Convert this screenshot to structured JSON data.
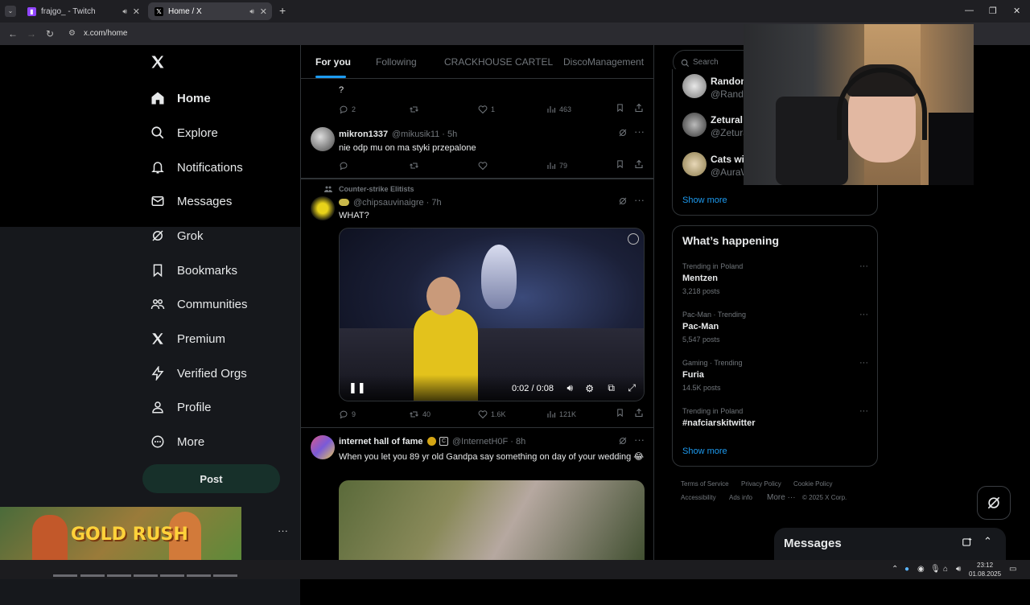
{
  "browser": {
    "tabs": [
      {
        "title": "frajgo_ - Twitch",
        "active": false
      },
      {
        "title": "Home / X",
        "active": true
      }
    ],
    "url": "x.com/home"
  },
  "leftnav": {
    "items": [
      {
        "label": "Home",
        "icon": "home-icon",
        "active": true
      },
      {
        "label": "Explore",
        "icon": "search-icon"
      },
      {
        "label": "Notifications",
        "icon": "bell-icon"
      },
      {
        "label": "Messages",
        "icon": "mail-icon"
      },
      {
        "label": "Grok",
        "icon": "grok-icon"
      },
      {
        "label": "Bookmarks",
        "icon": "bookmark-icon"
      },
      {
        "label": "Communities",
        "icon": "people-icon"
      },
      {
        "label": "Premium",
        "icon": "x-logo-icon"
      },
      {
        "label": "Verified Orgs",
        "icon": "lightning-icon"
      },
      {
        "label": "Profile",
        "icon": "person-icon"
      },
      {
        "label": "More",
        "icon": "more-circle-icon"
      }
    ],
    "post_label": "Post",
    "ad_title": "GOLD RUSH",
    "more_dots": "···"
  },
  "feed": {
    "tabs": [
      "For you",
      "Following",
      "CRACKHOUSE CARTEL",
      "DiscoManagement"
    ],
    "active_tab": 0,
    "tweets": [
      {
        "text": "?",
        "replies": "2",
        "retweets": "",
        "likes": "1",
        "views": "463"
      },
      {
        "name": "mikron1337",
        "handle": "@mikusik11 · 5h",
        "text": "nie odp mu on ma styki przepalone",
        "replies": "",
        "retweets": "",
        "likes": "",
        "views": "79"
      },
      {
        "community": "Counter-strike Elitists",
        "name": "",
        "handle": "@chipsauvinaigre · 7h",
        "text": "WHAT?",
        "video_time": "0:02 / 0:08",
        "replies": "9",
        "retweets": "40",
        "likes": "1.6K",
        "views": "121K"
      },
      {
        "name": "internet hall of fame",
        "handle": "@InternetH0F · 8h",
        "text": "When you let you 89 yr old Gandpa say something on day of your wedding 😂"
      }
    ]
  },
  "right": {
    "search_placeholder": "Search",
    "who_to_follow": [
      {
        "name": "Random",
        "handle": "@Rando"
      },
      {
        "name": "Zetural",
        "handle": "@Zetura"
      },
      {
        "name": "Cats wit",
        "handle": "@AuraW"
      }
    ],
    "show_more": "Show more",
    "happening_title": "What’s happening",
    "trends": [
      {
        "meta": "Trending in Poland",
        "name": "Mentzen",
        "posts": "3,218 posts"
      },
      {
        "meta": "Pac-Man · Trending",
        "name": "Pac-Man",
        "posts": "5,547 posts"
      },
      {
        "meta": "Gaming · Trending",
        "name": "Furia",
        "posts": "14.5K posts"
      },
      {
        "meta": "Trending in Poland",
        "name": "#nafciarskitwitter",
        "posts": ""
      }
    ],
    "show_more_2": "Show more",
    "footer": [
      "Terms of Service",
      "Privacy Policy",
      "Cookie Policy",
      "Accessibility",
      "Ads info",
      "More ···",
      "© 2025 X Corp."
    ],
    "messages_title": "Messages"
  },
  "taskbar": {
    "time": "23:12",
    "date": "01.08.2025"
  }
}
